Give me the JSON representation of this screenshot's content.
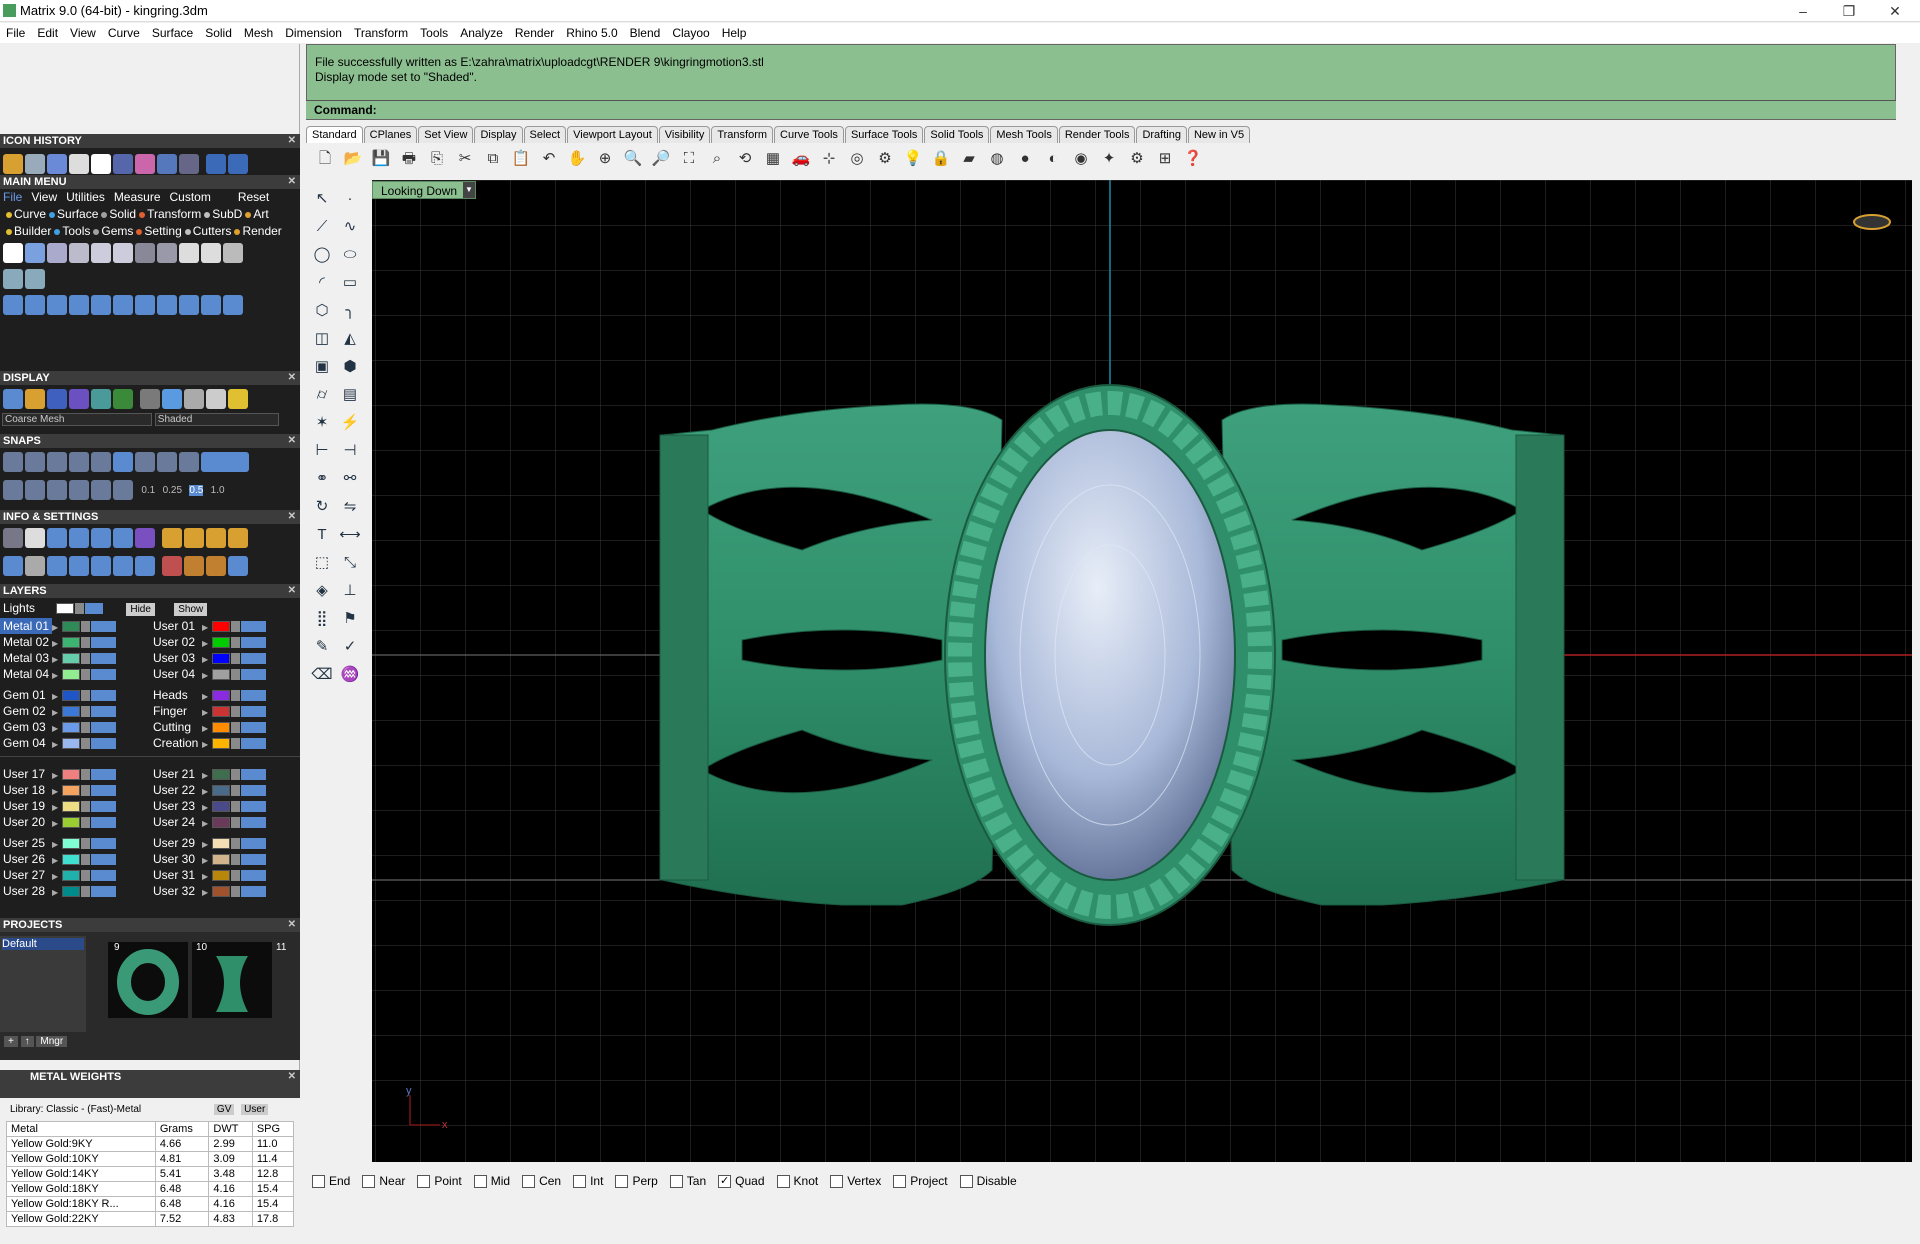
{
  "window": {
    "title": "Matrix 9.0 (64-bit) - kingring.3dm"
  },
  "menu": [
    "File",
    "Edit",
    "View",
    "Curve",
    "Surface",
    "Solid",
    "Mesh",
    "Dimension",
    "Transform",
    "Tools",
    "Analyze",
    "Render",
    "Rhino 5.0",
    "Blend",
    "Clayoo",
    "Help"
  ],
  "panels": {
    "icon_history": "ICON HISTORY",
    "main_menu": "MAIN MENU",
    "main_menu_tabs": [
      "File",
      "View",
      "Utilities",
      "Measure",
      "Custom"
    ],
    "main_menu_reset": "Reset",
    "main_menu_row1": [
      "Curve",
      "Surface",
      "Solid",
      "Transform",
      "SubD",
      "Art"
    ],
    "main_menu_row2": [
      "Builder",
      "Tools",
      "Gems",
      "Setting",
      "Cutters",
      "Render"
    ],
    "display": "DISPLAY",
    "display_mesh": "Coarse Mesh",
    "display_mode": "Shaded",
    "snaps": "SNAPS",
    "snap_values": [
      "0.1",
      "0.25",
      "0.5",
      "1.0"
    ],
    "info_settings": "INFO & SETTINGS",
    "layers": "LAYERS",
    "layers_lights": "Lights",
    "layers_hide": "Hide",
    "layers_show": "Show",
    "projects": "PROJECTS",
    "projects_default": "Default",
    "project_nums": [
      "9",
      "10",
      "11"
    ],
    "projects_mngr": "Mngr",
    "metal_weights": "METAL WEIGHTS",
    "metal_library": "Library: Classic - (Fast)-Metal",
    "metal_gv": "GV",
    "metal_user": "User"
  },
  "layers_left": [
    {
      "name": "Metal 01",
      "color": "#2e8b57"
    },
    {
      "name": "Metal 02",
      "color": "#3cb371"
    },
    {
      "name": "Metal 03",
      "color": "#66cdaa"
    },
    {
      "name": "Metal 04",
      "color": "#90ee90"
    },
    {
      "name": "Gem 01",
      "color": "#1e56c8"
    },
    {
      "name": "Gem 02",
      "color": "#3c78d8"
    },
    {
      "name": "Gem 03",
      "color": "#6a9ae8"
    },
    {
      "name": "Gem 04",
      "color": "#9ab8f0"
    },
    {
      "name": "User 17",
      "color": "#f08080"
    },
    {
      "name": "User 18",
      "color": "#f4a460"
    },
    {
      "name": "User 19",
      "color": "#eedd82"
    },
    {
      "name": "User 20",
      "color": "#9acd32"
    },
    {
      "name": "User 25",
      "color": "#7fffd4"
    },
    {
      "name": "User 26",
      "color": "#40e0d0"
    },
    {
      "name": "User 27",
      "color": "#20b2aa"
    },
    {
      "name": "User 28",
      "color": "#008b8b"
    }
  ],
  "layers_right": [
    {
      "name": "User 01",
      "color": "#ff0000"
    },
    {
      "name": "User 02",
      "color": "#00cc00"
    },
    {
      "name": "User 03",
      "color": "#0000ff"
    },
    {
      "name": "User 04",
      "color": "#a0a0a0"
    },
    {
      "name": "Heads",
      "color": "#8a2be2"
    },
    {
      "name": "Finger",
      "color": "#cc3333"
    },
    {
      "name": "Cutting",
      "color": "#ff8c00"
    },
    {
      "name": "Creation",
      "color": "#ffb400"
    },
    {
      "name": "User 21",
      "color": "#3e6e4e"
    },
    {
      "name": "User 22",
      "color": "#4a6a8a"
    },
    {
      "name": "User 23",
      "color": "#4a4a8a"
    },
    {
      "name": "User 24",
      "color": "#6a3a5a"
    },
    {
      "name": "User 29",
      "color": "#f5deb3"
    },
    {
      "name": "User 30",
      "color": "#d2b48c"
    },
    {
      "name": "User 31",
      "color": "#b8860b"
    },
    {
      "name": "User 32",
      "color": "#a0522d"
    }
  ],
  "metal_table": {
    "headers": [
      "Metal",
      "Grams",
      "DWT",
      "SPG"
    ],
    "rows": [
      [
        "Yellow Gold:9KY",
        "4.66",
        "2.99",
        "11.0"
      ],
      [
        "Yellow Gold:10KY",
        "4.81",
        "3.09",
        "11.4"
      ],
      [
        "Yellow Gold:14KY",
        "5.41",
        "3.48",
        "12.8"
      ],
      [
        "Yellow Gold:18KY",
        "6.48",
        "4.16",
        "15.4"
      ],
      [
        "Yellow Gold:18KY R...",
        "6.48",
        "4.16",
        "15.4"
      ],
      [
        "Yellow Gold:22KY",
        "7.52",
        "4.83",
        "17.8"
      ]
    ]
  },
  "command": {
    "line1": "File successfully written as E:\\zahra\\matrix\\uploadcgt\\RENDER 9\\kingringmotion3.stl",
    "line2": "Display mode set to \"Shaded\".",
    "prompt": "Command:"
  },
  "tabs": [
    "Standard",
    "CPlanes",
    "Set View",
    "Display",
    "Select",
    "Viewport Layout",
    "Visibility",
    "Transform",
    "Curve Tools",
    "Surface Tools",
    "Solid Tools",
    "Mesh Tools",
    "Render Tools",
    "Drafting",
    "New in V5"
  ],
  "viewport": {
    "label": "Looking Down",
    "axis_y": "y",
    "axis_x": "x"
  },
  "osnaps": [
    {
      "label": "End",
      "checked": false
    },
    {
      "label": "Near",
      "checked": false
    },
    {
      "label": "Point",
      "checked": false
    },
    {
      "label": "Mid",
      "checked": false
    },
    {
      "label": "Cen",
      "checked": false
    },
    {
      "label": "Int",
      "checked": false
    },
    {
      "label": "Perp",
      "checked": false
    },
    {
      "label": "Tan",
      "checked": false
    },
    {
      "label": "Quad",
      "checked": true
    },
    {
      "label": "Knot",
      "checked": false
    },
    {
      "label": "Vertex",
      "checked": false
    },
    {
      "label": "Project",
      "checked": false
    },
    {
      "label": "Disable",
      "checked": false
    }
  ],
  "colors": {
    "accent_green": "#8cbf90",
    "ring_green": "#2f8f6a",
    "gem": "#c8d4ea"
  }
}
